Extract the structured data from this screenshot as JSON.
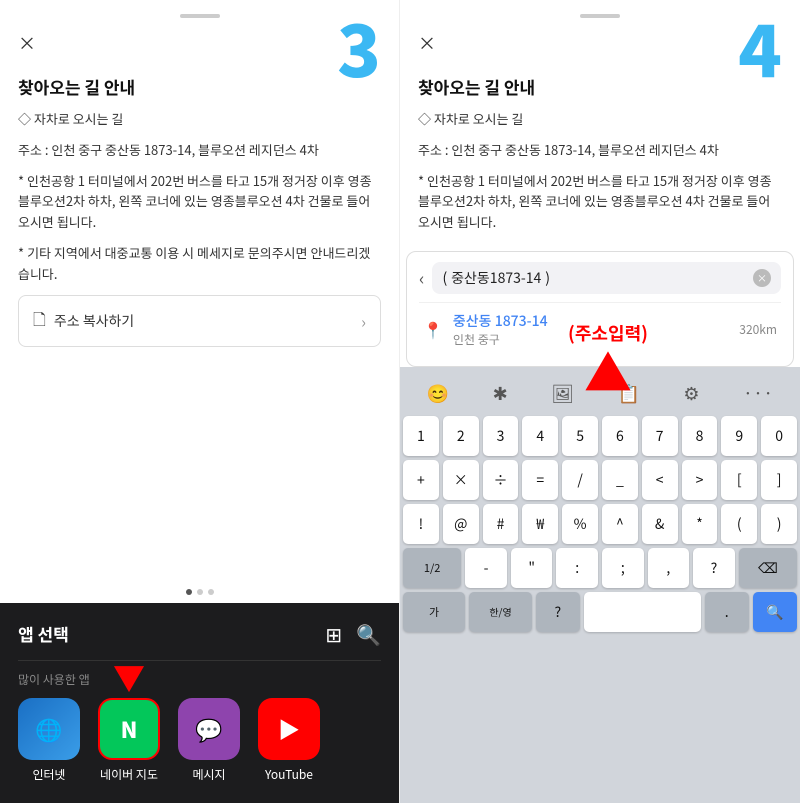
{
  "left": {
    "step_number": "3",
    "close_btn": "×",
    "modal_title": "찾아오는 길 안내",
    "para1": "◇ 자차로 오시는 길",
    "para2": "주소 : 인천 중구 중산동 1873-14, 블루오션 레지던스 4차",
    "para3": "",
    "para4": "* 인천공항 1 터미널에서 202번 버스를 타고 15개 정거장 이후 영종블루오션2차 하차, 왼쪽 코너에 있는 영종블루오션 4차 건물로 들어오시면 됩니다.",
    "para5": "",
    "para6": "* 기타 지역에서 대중교통 이용 시 메세지로 문의주시면 안내드리겠습니다.",
    "copy_address_label": "주소 복사하기",
    "app_select_title": "앱 선택",
    "section_label": "많이 사용한 앱",
    "apps": [
      {
        "id": "internet",
        "label": "인터넷"
      },
      {
        "id": "naver",
        "label": "네이버 지도"
      },
      {
        "id": "message",
        "label": "메시지"
      },
      {
        "id": "youtube",
        "label": "YouTube"
      }
    ]
  },
  "right": {
    "step_number": "4",
    "close_btn": "×",
    "modal_title": "찾아오는 길 안내",
    "para1": "◇ 자차로 오시는 길",
    "para2": "주소 : 인천 중구 중산동 1873-14, 블루오션 레지던스 4차",
    "para3": "",
    "para4": "* 인천공항 1 터미널에서 202번 버스를 타고 15개 정거장 이후 영종블루오션2차 하차, 왼쪽 코너에 있는 영종블루오션 4차 건물로 들어오시면 됩니다.",
    "search_placeholder": "중산동1873-14",
    "search_result_main": "중산동 1873-14",
    "search_result_sub": "인천 중구",
    "search_result_distance": "320km",
    "arrow_annotation": "(주소입력)",
    "keyboard": {
      "toolbar_icons": [
        "😊",
        "✱",
        "🖼",
        "📋",
        "⚙",
        "···"
      ],
      "row1": [
        "1",
        "2",
        "3",
        "4",
        "5",
        "6",
        "7",
        "8",
        "9",
        "0"
      ],
      "row2": [
        "+",
        "×",
        "÷",
        "=",
        "/",
        "_",
        "<",
        ">",
        "[",
        "]"
      ],
      "row3": [
        "!",
        "@",
        "#",
        "₩",
        "%",
        "^",
        "&",
        "*",
        "(",
        ")"
      ],
      "row4_left": "1/2",
      "row4_mid": [
        "-",
        "“",
        ":",
        ";",
        ",",
        "?"
      ],
      "row4_del": "⌫",
      "row5_lang": "가",
      "row5_lang2": "한/영",
      "row5_q": "?",
      "row5_space": "",
      "row5_period": ".",
      "row5_search": "🔍"
    }
  }
}
